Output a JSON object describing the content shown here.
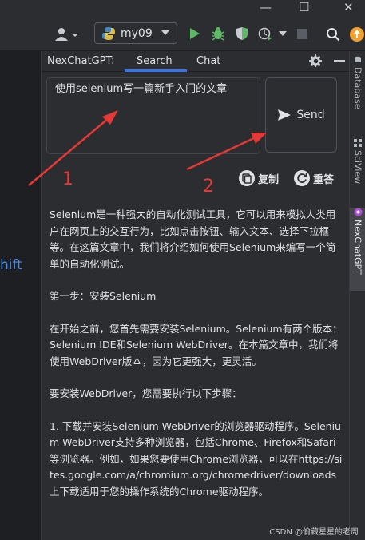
{
  "toolbar": {
    "run_config": "my09"
  },
  "left_partial": "hift",
  "right_tabs": [
    "Database",
    "SciView",
    "NexChatGPT"
  ],
  "tool": {
    "title": "NexChatGPT:",
    "tabs": [
      "Search",
      "Chat"
    ],
    "active_tab": "Search",
    "question": "使用selenium写一篇新手入门的文章",
    "send_label": "Send",
    "copy_label": "复制",
    "retry_label": "重答"
  },
  "answer": [
    "Selenium是一种强大的自动化测试工具，它可以用来模拟人类用户在网页上的交互行为，比如点击按钮、输入文本、选择下拉框等。在这篇文章中，我们将介绍如何使用Selenium来编写一个简单的自动化测试。",
    "第一步：安装Selenium",
    "在开始之前，您首先需要安装Selenium。Selenium有两个版本：Selenium IDE和Selenium WebDriver。在本篇文章中，我们将使用WebDriver版本，因为它更强大，更灵活。",
    "要安装WebDriver，您需要执行以下步骤：",
    "1. 下载并安装Selenium WebDriver的浏览器驱动程序。Selenium WebDriver支持多种浏览器，包括Chrome、Firefox和Safari等浏览器。例如，如果您要使用Chrome浏览器，可以在https://sites.google.com/a/chromium.org/chromedriver/downloads上下载适用于您的操作系统的Chrome驱动程序。"
  ],
  "annotations": [
    "1",
    "2"
  ],
  "watermark": "CSDN @偷藏星星的老周",
  "colors": {
    "accent": "#3574f0",
    "run_green": "#5fb865",
    "annotation_red": "#e53935",
    "badge_orange": "#f0a030"
  }
}
